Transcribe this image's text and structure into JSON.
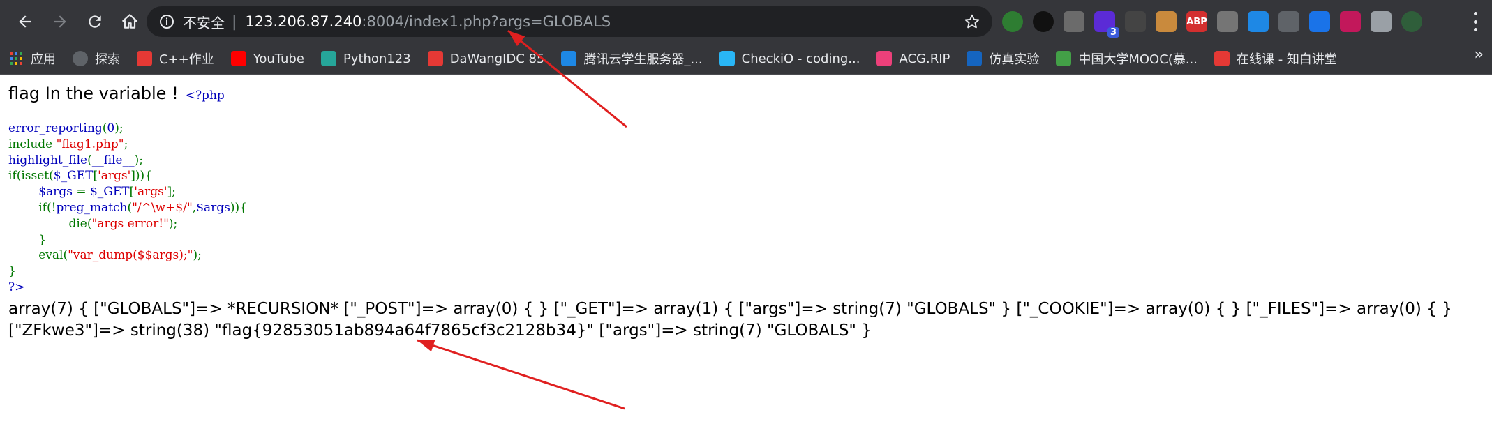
{
  "browser": {
    "insecure_label": "不安全",
    "url_host": "123.206.87.240",
    "url_rest": ":8004/index1.php?args=GLOBALS",
    "extensions": [
      {
        "name": "ext-leaf-icon",
        "color": "#2e7d32",
        "text": ""
      },
      {
        "name": "ext-circle-icon",
        "color": "#111111",
        "text": ""
      },
      {
        "name": "ext-gear-cog-icon",
        "color": "#6b6b6b",
        "text": ""
      },
      {
        "name": "ext-purple-icon",
        "color": "#5b2bd6",
        "text": "",
        "badge": "3"
      },
      {
        "name": "ext-gear-icon",
        "color": "#444444",
        "text": ""
      },
      {
        "name": "ext-cookie-icon",
        "color": "#c98a3d",
        "text": ""
      },
      {
        "name": "ext-abp-icon",
        "color": "#d32f2f",
        "text": "ABP"
      },
      {
        "name": "ext-download-icon",
        "color": "#757575",
        "text": ""
      },
      {
        "name": "ext-hex-icon",
        "color": "#1e88e5",
        "text": ""
      },
      {
        "name": "ext-glasses-icon",
        "color": "#5f6368",
        "text": ""
      },
      {
        "name": "ext-bookmark-icon",
        "color": "#1a73e8",
        "text": ""
      },
      {
        "name": "ext-photo-icon",
        "color": "#c2185b",
        "text": ""
      },
      {
        "name": "ext-puzzle-icon",
        "color": "#9aa0a6",
        "text": ""
      },
      {
        "name": "ext-avatar-icon",
        "color": "#2f5e3a",
        "text": ""
      }
    ]
  },
  "bookmarks": [
    {
      "label": "应用",
      "icon": "apps-grid-icon",
      "color": "#e8622f"
    },
    {
      "label": "探索",
      "icon": "github-icon",
      "color": "#5f6368"
    },
    {
      "label": "C++作业",
      "icon": "cpp-icon",
      "color": "#e53935"
    },
    {
      "label": "YouTube",
      "icon": "youtube-icon",
      "color": "#ff0000"
    },
    {
      "label": "Python123",
      "icon": "python123-icon",
      "color": "#26a69a"
    },
    {
      "label": "DaWangIDC 85",
      "icon": "dawang-icon",
      "color": "#e53935"
    },
    {
      "label": "腾讯云学生服务器_...",
      "icon": "tencent-cloud-icon",
      "color": "#1e88e5"
    },
    {
      "label": "CheckiO - coding...",
      "icon": "checkio-icon",
      "color": "#29b6f6"
    },
    {
      "label": "ACG.RIP",
      "icon": "acg-icon",
      "color": "#ec407a"
    },
    {
      "label": "仿真实验",
      "icon": "sim-icon",
      "color": "#1565c0"
    },
    {
      "label": "中国大学MOOC(慕...",
      "icon": "mooc-icon",
      "color": "#43a047"
    },
    {
      "label": "在线课 - 知白讲堂",
      "icon": "zhibai-icon",
      "color": "#e53935"
    }
  ],
  "page": {
    "heading": "flag In the variable !",
    "php_open": "<?php",
    "code": {
      "l1a": "error_reporting",
      "l1b": "(",
      "l1c": "0",
      "l1d": ");",
      "l2a": "include ",
      "l2b": "\"flag1.php\"",
      "l2c": ";",
      "l3a": "highlight_file",
      "l3b": "(",
      "l3c": "__file__",
      "l3d": ");",
      "l4a": "if(isset(",
      "l4b": "$_GET",
      "l4c": "[",
      "l4d": "'args'",
      "l4e": "])){",
      "l5a": "        ",
      "l5b": "$args",
      "l5c": " = ",
      "l5d": "$_GET",
      "l5e": "[",
      "l5f": "'args'",
      "l5g": "];",
      "l6a": "        if(!",
      "l6b": "preg_match",
      "l6c": "(",
      "l6d": "\"/^\\w+$/\"",
      "l6e": ",",
      "l6f": "$args",
      "l6g": ")){",
      "l7a": "                die(",
      "l7b": "\"args error!\"",
      "l7c": ");",
      "l8": "        }",
      "l9a": "        eval(",
      "l9b": "\"var_dump($$args);\"",
      "l9c": ");",
      "l10": "}",
      "l11": "?>"
    },
    "dump": "array(7) { [\"GLOBALS\"]=> *RECURSION* [\"_POST\"]=> array(0) { } [\"_GET\"]=> array(1) { [\"args\"]=> string(7) \"GLOBALS\" } [\"_COOKIE\"]=> array(0) { } [\"_FILES\"]=> array(0) { } [\"ZFkwe3\"]=> string(38) \"flag{92853051ab894a64f7865cf3c2128b34}\" [\"args\"]=> string(7) \"GLOBALS\" }"
  },
  "annotation_color": "#e02020"
}
